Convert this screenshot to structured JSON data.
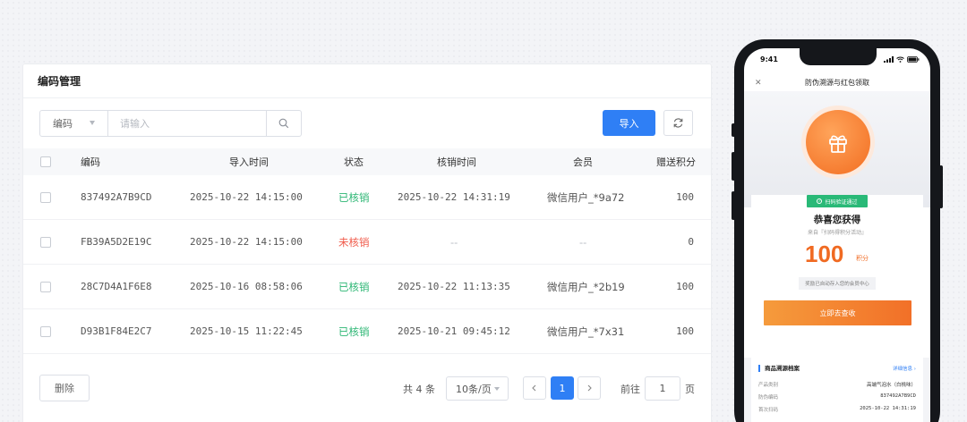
{
  "admin": {
    "title": "编码管理",
    "search": {
      "field": "编码",
      "placeholder": "请输入"
    },
    "import_label": "导入",
    "columns": [
      "编码",
      "导入时间",
      "状态",
      "核销时间",
      "会员",
      "赠送积分"
    ],
    "rows": [
      {
        "code": "837492A7B9CD",
        "import_time": "2025-10-22 14:15:00",
        "status": "已核销",
        "verify_time": "2025-10-22 14:31:19",
        "member": "微信用户_*9a72",
        "points": "100"
      },
      {
        "code": "FB39A5D2E19C",
        "import_time": "2025-10-22 14:15:00",
        "status": "未核销",
        "verify_time": "--",
        "member": "--",
        "points": "0"
      },
      {
        "code": "28C7D4A1F6E8",
        "import_time": "2025-10-16 08:58:06",
        "status": "已核销",
        "verify_time": "2025-10-22 11:13:35",
        "member": "微信用户_*2b19",
        "points": "100"
      },
      {
        "code": "D93B1F84E2C7",
        "import_time": "2025-10-15 11:22:45",
        "status": "已核销",
        "verify_time": "2025-10-21 09:45:12",
        "member": "微信用户_*7x31",
        "points": "100"
      }
    ],
    "footer": {
      "delete_label": "删除",
      "total": "共 4 条",
      "page_size": "10条/页",
      "current_page": "1",
      "goto_label": "前往",
      "goto_value": "1",
      "page_unit": "页"
    }
  },
  "phone": {
    "time": "9:41",
    "nav_title": "防伪溯源与红包领取",
    "verify_badge": "扫码验证通过",
    "congrats": "恭喜您获得",
    "from": "来自『扫码得积分活动』",
    "points": "100",
    "points_unit": "积分",
    "issued_note": "奖励已自动存入您的会员中心",
    "query_button": "立即去查收",
    "archive": {
      "title": "商品溯源档案",
      "detail_link": "详细信息 ›",
      "fields": [
        {
          "key": "产品类别",
          "value": "高端气泡水（白桃味）"
        },
        {
          "key": "防伪编码",
          "value": "837492A7B9CD"
        },
        {
          "key": "首次扫码",
          "value": "2025-10-22 14:31:19"
        }
      ]
    }
  },
  "colors": {
    "primary": "#2f7ff5",
    "success": "#2bb673",
    "danger": "#f05a4a",
    "accent": "#f06a22"
  }
}
